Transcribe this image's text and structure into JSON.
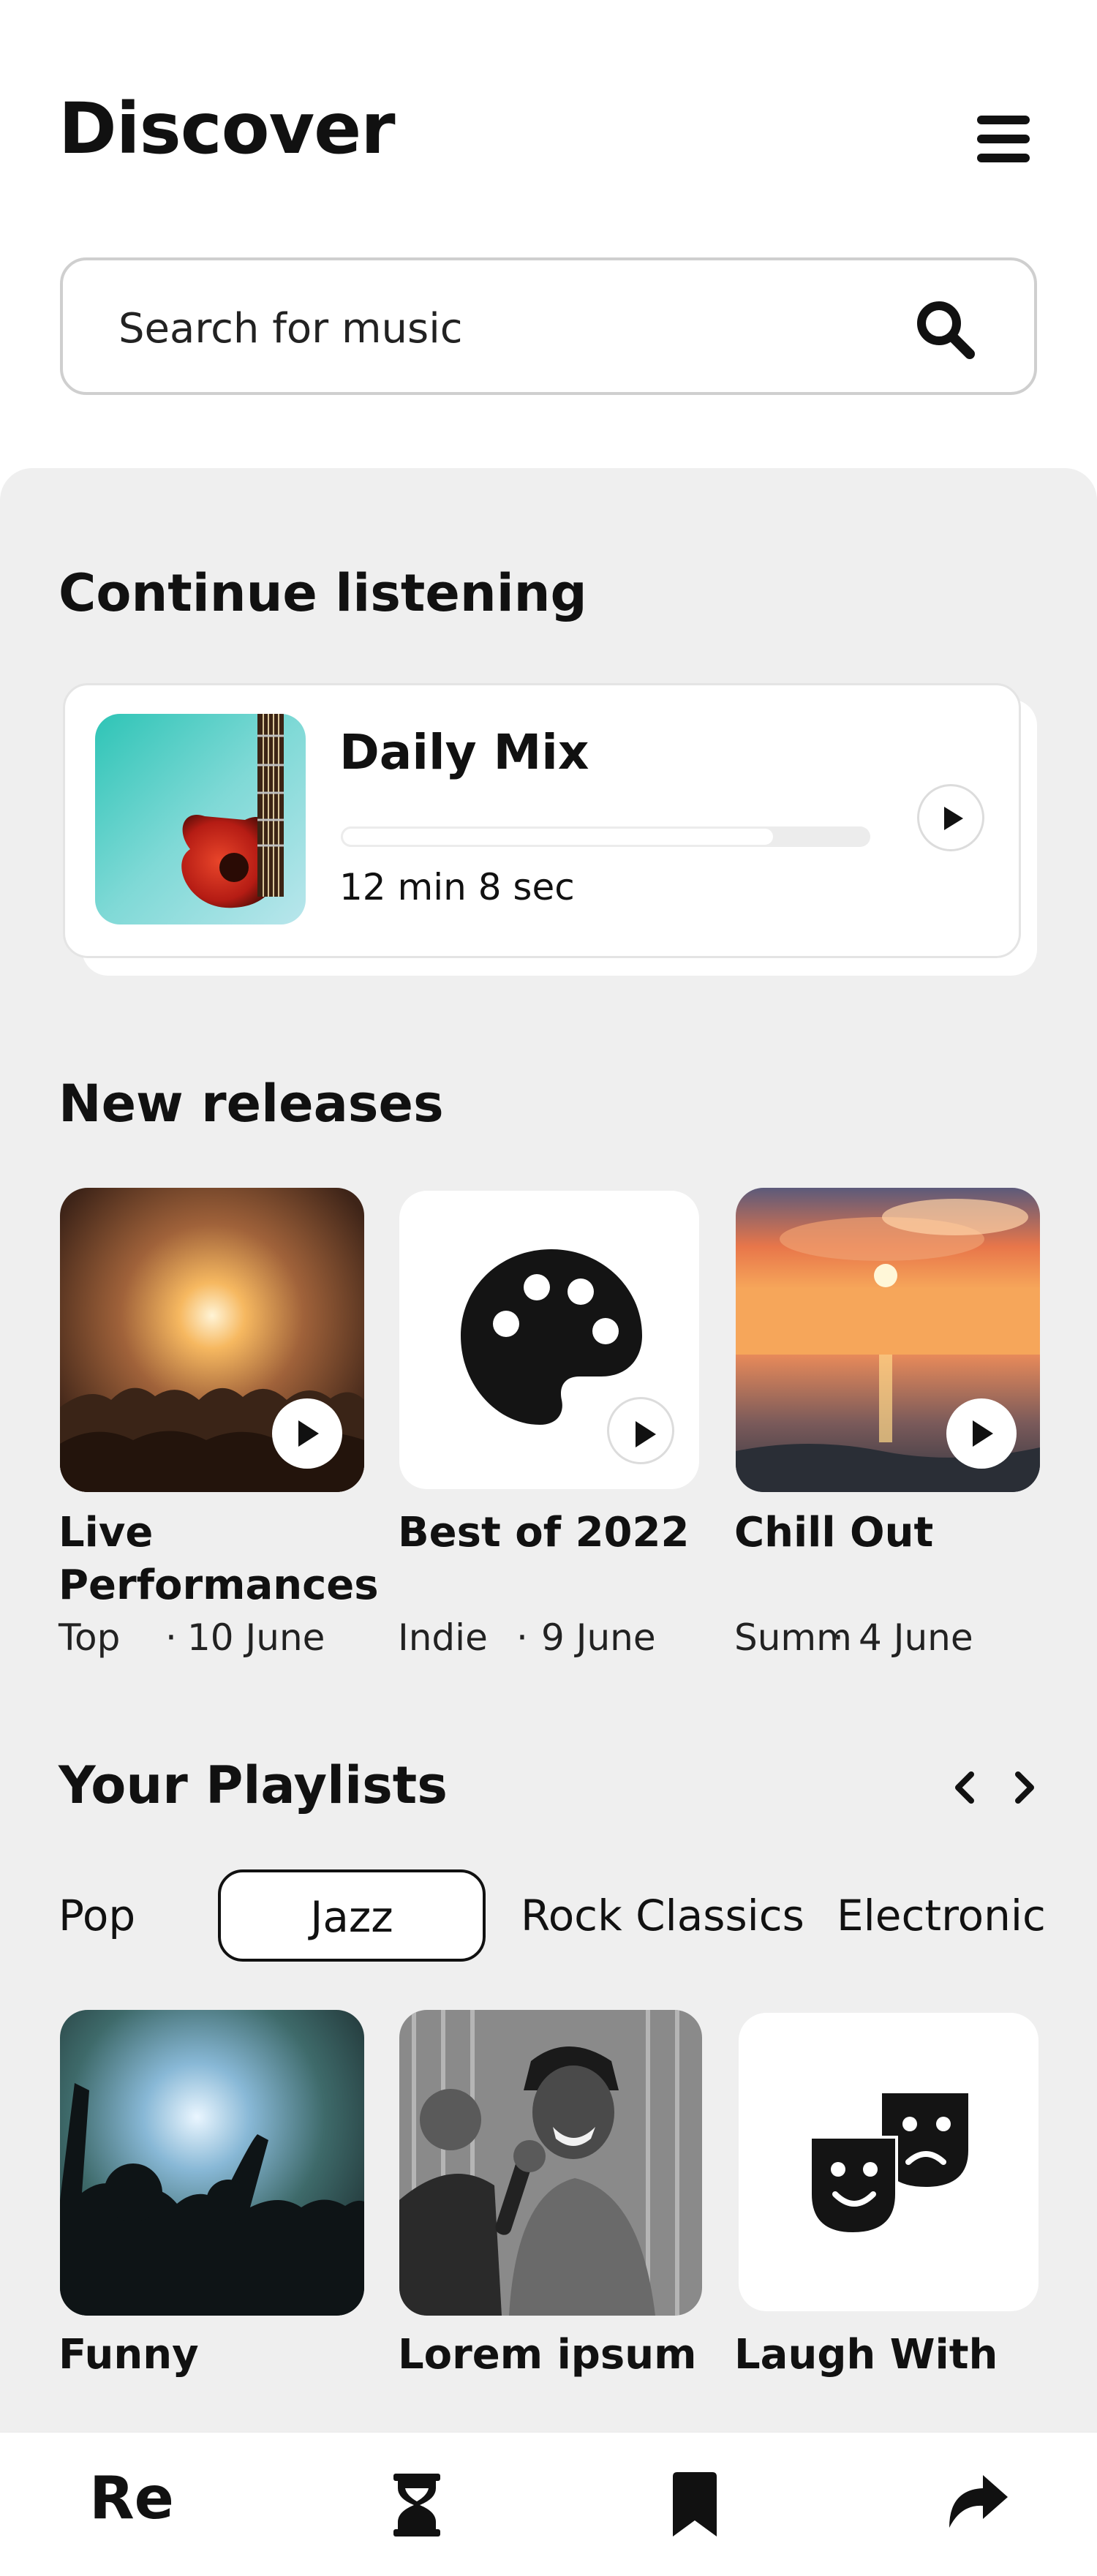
{
  "header": {
    "title": "Discover"
  },
  "search": {
    "placeholder": "Search for music"
  },
  "continue_listening": {
    "heading": "Continue listening",
    "item": {
      "title": "Daily Mix",
      "time": "12 min 8 sec",
      "progress": 0.82
    }
  },
  "new_releases": {
    "heading": "New releases",
    "items": [
      {
        "title": "Live Performances",
        "genre": "Top",
        "date": "10 June"
      },
      {
        "title": "Best of 2022",
        "genre": "Indie",
        "date": "9 June"
      },
      {
        "title": "Chill Out",
        "genre": "Summ",
        "date": "4 June"
      }
    ]
  },
  "playlists": {
    "heading": "Your Playlists",
    "tabs": [
      "Pop",
      "Jazz",
      "Rock Classics",
      "Electronic"
    ],
    "active_tab": "Jazz",
    "items": [
      {
        "title": "Funny"
      },
      {
        "title": "Lorem ipsum"
      },
      {
        "title": "Laugh With"
      }
    ]
  },
  "bottom_nav": {
    "first_label": "Re"
  },
  "icons": {
    "menu": "hamburger-menu-icon",
    "search": "search-icon",
    "play": "play-icon",
    "palette": "palette-icon",
    "theater": "theater-masks-icon",
    "hourglass": "hourglass-icon",
    "bookmark": "bookmark-icon",
    "share": "share-icon"
  },
  "colors": {
    "text": "#111111",
    "panel": "#efefef",
    "card": "#ffffff",
    "border": "#cfcfcf"
  }
}
